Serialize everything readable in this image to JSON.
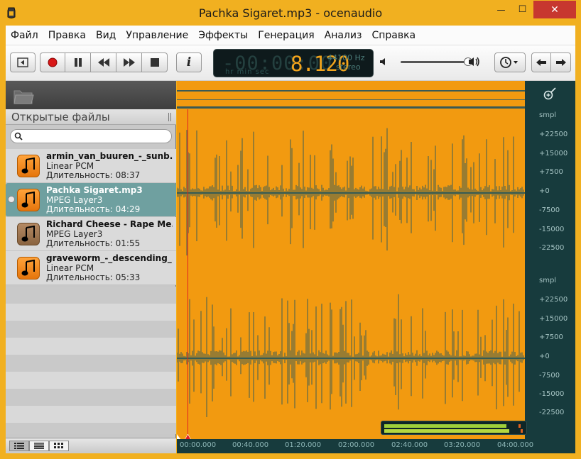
{
  "window": {
    "title": "Pachka Sigaret.mp3 - ocenaudio",
    "minimize": "—",
    "maximize": "☐",
    "close": "✕"
  },
  "menu": [
    "Файл",
    "Правка",
    "Вид",
    "Управление",
    "Эффекты",
    "Генерация",
    "Анализ",
    "Справка"
  ],
  "toolbar": {
    "icons": [
      "back-to-start-icon",
      "record-icon",
      "pause-icon",
      "rewind-icon",
      "fast-forward-icon",
      "stop-icon",
      "info-icon",
      "volume-low-icon",
      "volume-high-icon",
      "clock-icon",
      "arrow-left-icon",
      "arrow-right-icon"
    ],
    "info_label": "i",
    "volume_level": 0.95
  },
  "display": {
    "ghost": "-00:00:00",
    "units": "hr  min  sec",
    "time": "8.120",
    "rate": "44100 Hz",
    "channels": "stereo"
  },
  "sidebar": {
    "header": "Открытые файлы",
    "search_placeholder": "",
    "files": [
      {
        "name": "armin_van_buuren_-_sunb...",
        "format": "Linear PCM",
        "duration": "Длительность: 08:37",
        "selected": false
      },
      {
        "name": "Pachka Sigaret.mp3",
        "format": "MPEG Layer3",
        "duration": "Длительность: 04:29",
        "selected": true
      },
      {
        "name": "Richard Cheese - Rape Me...",
        "format": "MPEG Layer3",
        "duration": "Длительность: 01:55",
        "selected": false
      },
      {
        "name": "graveworm_-_descending_...",
        "format": "Linear PCM",
        "duration": "Длительность: 05:33",
        "selected": false
      }
    ],
    "view_modes": [
      "list-view-icon",
      "detail-view-icon",
      "grid-view-icon"
    ]
  },
  "waveform": {
    "wave_color": "#f29a10",
    "ruler_color": "#173b3d",
    "time_ticks": [
      "00:00.000",
      "00:40.000",
      "01:20.000",
      "02:00.000",
      "02:40.000",
      "03:20.000",
      "04:00.000"
    ],
    "amp_ticks_ch1": [
      "smpl",
      "+22500",
      "+15000",
      "+7500",
      "+0",
      "-7500",
      "-15000",
      "-22500"
    ],
    "amp_ticks_ch2": [
      "smpl",
      "+22500",
      "+15000",
      "+7500",
      "+0",
      "-7500",
      "-15000",
      "-22500"
    ]
  }
}
